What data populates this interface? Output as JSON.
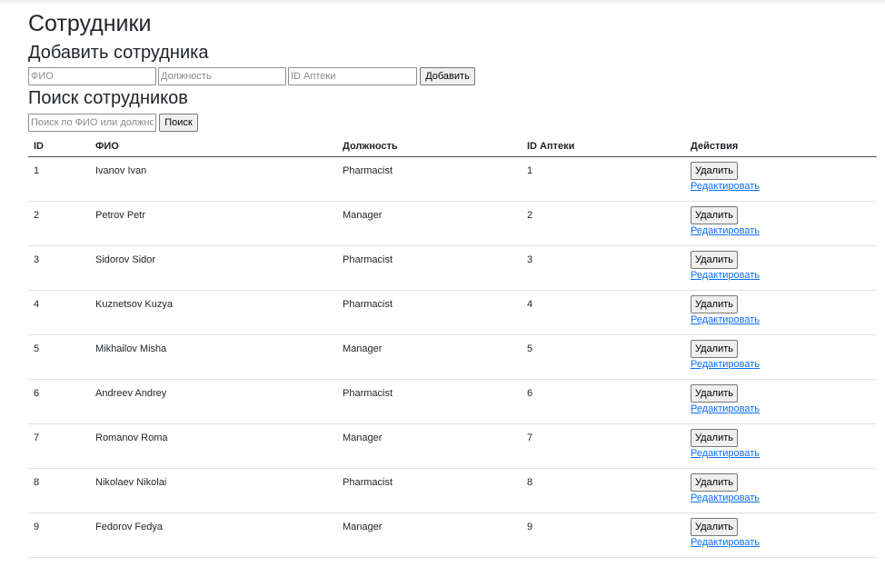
{
  "page": {
    "title": "Сотрудники"
  },
  "add_form": {
    "heading": "Добавить сотрудника",
    "name_placeholder": "ФИО",
    "position_placeholder": "Должность",
    "pharmacy_placeholder": "ID Аптеки",
    "submit_label": "Добавить"
  },
  "search_form": {
    "heading": "Поиск сотрудников",
    "query_placeholder": "Поиск по ФИО или должности",
    "submit_label": "Поиск"
  },
  "table": {
    "columns": [
      "ID",
      "ФИО",
      "Должность",
      "ID Аптеки",
      "Действия"
    ],
    "delete_label": "Удалить",
    "edit_label": "Редактировать",
    "rows": [
      {
        "id": "1",
        "name": "Ivanov Ivan",
        "position": "Pharmacist",
        "pharmacy_id": "1"
      },
      {
        "id": "2",
        "name": "Petrov Petr",
        "position": "Manager",
        "pharmacy_id": "2"
      },
      {
        "id": "3",
        "name": "Sidorov Sidor",
        "position": "Pharmacist",
        "pharmacy_id": "3"
      },
      {
        "id": "4",
        "name": "Kuznetsov Kuzya",
        "position": "Pharmacist",
        "pharmacy_id": "4"
      },
      {
        "id": "5",
        "name": "Mikhailov Misha",
        "position": "Manager",
        "pharmacy_id": "5"
      },
      {
        "id": "6",
        "name": "Andreev Andrey",
        "position": "Pharmacist",
        "pharmacy_id": "6"
      },
      {
        "id": "7",
        "name": "Romanov Roma",
        "position": "Manager",
        "pharmacy_id": "7"
      },
      {
        "id": "8",
        "name": "Nikolaev Nikolai",
        "position": "Pharmacist",
        "pharmacy_id": "8"
      },
      {
        "id": "9",
        "name": "Fedorov Fedya",
        "position": "Manager",
        "pharmacy_id": "9"
      }
    ]
  },
  "colors": {
    "link": "#0d6efd",
    "header_border": "#454d55",
    "row_border": "#dee2e6"
  }
}
